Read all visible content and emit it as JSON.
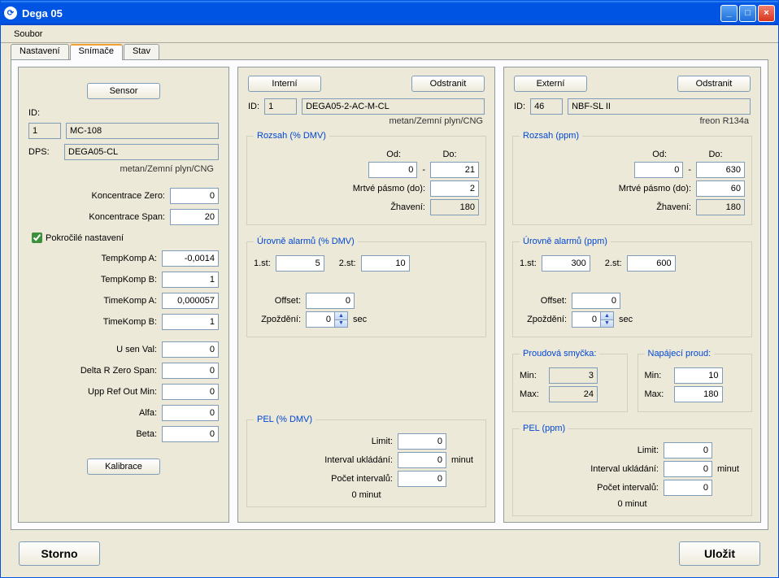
{
  "title": "Dega 05",
  "menu": {
    "soubor": "Soubor"
  },
  "tabs": {
    "nastaveni": "Nastavení",
    "snimace": "Snímače",
    "stav": "Stav"
  },
  "labels": {
    "id": "ID:",
    "dps": "DPS:",
    "koncZero": "Koncentrace Zero:",
    "koncSpan": "Koncentrace Span:",
    "pokrocile": "Pokročilé nastavení",
    "tempKompA": "TempKomp A:",
    "tempKompB": "TempKomp B:",
    "timeKompA": "TimeKomp A:",
    "timeKompB": "TimeKomp B:",
    "uSenVal": "U sen Val:",
    "deltaR": "Delta R Zero Span:",
    "uppRef": "Upp Ref Out Min:",
    "alfa": "Alfa:",
    "beta": "Beta:",
    "od": "Od:",
    "do": "Do:",
    "mrtve": "Mrtvé pásmo (do):",
    "zhaveni": "Žhavení:",
    "st1": "1.st:",
    "st2": "2.st:",
    "offset": "Offset:",
    "zpozdeni": "Zpoždění:",
    "sec": "sec",
    "min": "Min:",
    "max": "Max:",
    "limit": "Limit:",
    "interval": "Interval ukládání:",
    "pocet": "Počet intervalů:",
    "minut": "minut",
    "minut0": "0 minut"
  },
  "buttons": {
    "sensor": "Sensor",
    "kalibrace": "Kalibrace",
    "interni": "Interní",
    "externi": "Externí",
    "odstranit": "Odstranit",
    "storno": "Storno",
    "ulozit": "Uložit"
  },
  "left": {
    "id": "1",
    "name": "MC-108",
    "dps": "DEGA05-CL",
    "gas": "metan/Zemní plyn/CNG",
    "koncZero": "0",
    "koncSpan": "20",
    "pokrocile": true,
    "tempKompA": "-0,0014",
    "tempKompB": "1",
    "timeKompA": "0,000057",
    "timeKompB": "1",
    "uSenVal": "0",
    "deltaR": "0",
    "uppRef": "0",
    "alfa": "0",
    "beta": "0"
  },
  "mid": {
    "id": "1",
    "name": "DEGA05-2-AC-M-CL",
    "gas": "metan/Zemní plyn/CNG",
    "rozsah_legend": "Rozsah (% DMV)",
    "od": "0",
    "do": "21",
    "mrtve": "2",
    "zhaveni": "180",
    "alarm_legend": "Úrovně alarmů (% DMV)",
    "st1": "5",
    "st2": "10",
    "offset": "0",
    "zpozdeni": "0",
    "pel_legend": "PEL (% DMV)",
    "limit": "0",
    "interval": "0",
    "pocet": "0"
  },
  "right": {
    "id": "46",
    "name": "NBF-SL II",
    "gas": "freon R134a",
    "rozsah_legend": "Rozsah (ppm)",
    "od": "0",
    "do": "630",
    "mrtve": "60",
    "zhaveni": "180",
    "alarm_legend": "Úrovně alarmů (ppm)",
    "st1": "300",
    "st2": "600",
    "offset": "0",
    "zpozdeni": "0",
    "loop_legend": "Proudová smyčka:",
    "loop_min": "3",
    "loop_max": "24",
    "power_legend": "Napájecí proud:",
    "power_min": "10",
    "power_max": "180",
    "pel_legend": "PEL (ppm)",
    "limit": "0",
    "interval": "0",
    "pocet": "0"
  }
}
